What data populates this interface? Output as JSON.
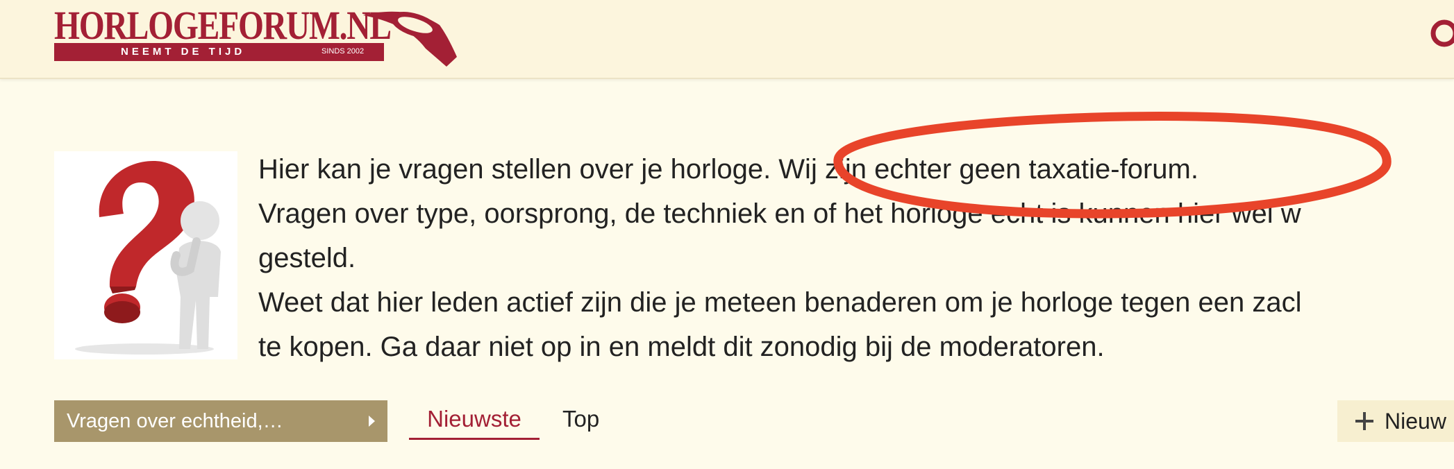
{
  "header": {
    "logo": {
      "wordmark": "HORLOGEFORUM.NL",
      "tagline": "NEEMT DE TIJD",
      "since": "SINDS 2002"
    },
    "search_icon": "search-icon"
  },
  "intro": {
    "image_icon": "question-mark-figure-icon",
    "line1": "Hier kan je vragen stellen over je horloge. Wij zijn echter geen taxatie-forum.",
    "line2": "Vragen over type, oorsprong, de techniek en of het horloge echt is kunnen hier wél w",
    "line3": "gesteld.",
    "line4": "Weet dat hier leden actief zijn die je meteen benaderen om je horloge tegen een zacl",
    "line5": "te kopen. Ga daar niet op in en meldt dit zonodig bij de moderatoren."
  },
  "annotation": {
    "color": "#e8442a"
  },
  "navigation": {
    "category_label": "Vragen over echtheid,…",
    "tabs": [
      {
        "label": "Nieuwste",
        "active": true
      },
      {
        "label": "Top",
        "active": false
      }
    ],
    "new_topic_label": "Nieuw"
  },
  "colors": {
    "brand": "#a32035",
    "header_bg": "#fcf5dd",
    "page_bg": "#fefbeb",
    "category_bg": "#a8966b"
  }
}
